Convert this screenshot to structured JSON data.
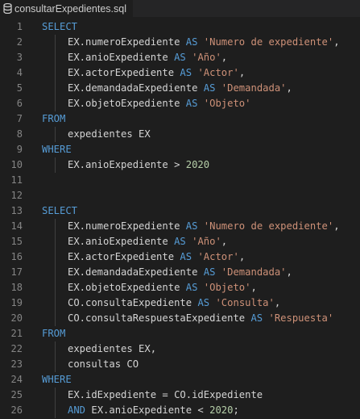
{
  "tab": {
    "title": "consultarExpedientes.sql",
    "icon": "database-icon"
  },
  "colors": {
    "keyword": "#569cd6",
    "string": "#ce9178",
    "number": "#b5cea8",
    "text": "#d4d4d4",
    "line_number": "#858585",
    "background": "#1e1e1e"
  },
  "lines": [
    {
      "n": "1",
      "indent": false,
      "tokens": [
        {
          "t": "SELECT",
          "c": "kw"
        }
      ]
    },
    {
      "n": "2",
      "indent": true,
      "tokens": [
        {
          "t": "EX.numeroExpediente ",
          "c": "id"
        },
        {
          "t": "AS",
          "c": "kw"
        },
        {
          "t": " ",
          "c": "id"
        },
        {
          "t": "'Numero de expediente'",
          "c": "str"
        },
        {
          "t": ",",
          "c": "id"
        }
      ]
    },
    {
      "n": "3",
      "indent": true,
      "tokens": [
        {
          "t": "EX.anioExpediente ",
          "c": "id"
        },
        {
          "t": "AS",
          "c": "kw"
        },
        {
          "t": " ",
          "c": "id"
        },
        {
          "t": "'Año'",
          "c": "str"
        },
        {
          "t": ",",
          "c": "id"
        }
      ]
    },
    {
      "n": "4",
      "indent": true,
      "tokens": [
        {
          "t": "EX.actorExpediente ",
          "c": "id"
        },
        {
          "t": "AS",
          "c": "kw"
        },
        {
          "t": " ",
          "c": "id"
        },
        {
          "t": "'Actor'",
          "c": "str"
        },
        {
          "t": ",",
          "c": "id"
        }
      ]
    },
    {
      "n": "5",
      "indent": true,
      "tokens": [
        {
          "t": "EX.demandadaExpediente ",
          "c": "id"
        },
        {
          "t": "AS",
          "c": "kw"
        },
        {
          "t": " ",
          "c": "id"
        },
        {
          "t": "'Demandada'",
          "c": "str"
        },
        {
          "t": ",",
          "c": "id"
        }
      ]
    },
    {
      "n": "6",
      "indent": true,
      "tokens": [
        {
          "t": "EX.objetoExpediente ",
          "c": "id"
        },
        {
          "t": "AS",
          "c": "kw"
        },
        {
          "t": " ",
          "c": "id"
        },
        {
          "t": "'Objeto'",
          "c": "str"
        }
      ]
    },
    {
      "n": "7",
      "indent": false,
      "tokens": [
        {
          "t": "FROM",
          "c": "kw"
        }
      ]
    },
    {
      "n": "8",
      "indent": true,
      "tokens": [
        {
          "t": "expedientes EX",
          "c": "id"
        }
      ]
    },
    {
      "n": "9",
      "indent": false,
      "tokens": [
        {
          "t": "WHERE",
          "c": "kw"
        }
      ]
    },
    {
      "n": "10",
      "indent": true,
      "tokens": [
        {
          "t": "EX.anioExpediente > ",
          "c": "id"
        },
        {
          "t": "2020",
          "c": "num"
        }
      ]
    },
    {
      "n": "11",
      "indent": false,
      "tokens": []
    },
    {
      "n": "12",
      "indent": false,
      "tokens": []
    },
    {
      "n": "13",
      "indent": false,
      "tokens": [
        {
          "t": "SELECT",
          "c": "kw"
        }
      ]
    },
    {
      "n": "14",
      "indent": true,
      "tokens": [
        {
          "t": "EX.numeroExpediente ",
          "c": "id"
        },
        {
          "t": "AS",
          "c": "kw"
        },
        {
          "t": " ",
          "c": "id"
        },
        {
          "t": "'Numero de expediente'",
          "c": "str"
        },
        {
          "t": ",",
          "c": "id"
        }
      ]
    },
    {
      "n": "15",
      "indent": true,
      "tokens": [
        {
          "t": "EX.anioExpediente ",
          "c": "id"
        },
        {
          "t": "AS",
          "c": "kw"
        },
        {
          "t": " ",
          "c": "id"
        },
        {
          "t": "'Año'",
          "c": "str"
        },
        {
          "t": ",",
          "c": "id"
        }
      ]
    },
    {
      "n": "16",
      "indent": true,
      "tokens": [
        {
          "t": "EX.actorExpediente ",
          "c": "id"
        },
        {
          "t": "AS",
          "c": "kw"
        },
        {
          "t": " ",
          "c": "id"
        },
        {
          "t": "'Actor'",
          "c": "str"
        },
        {
          "t": ",",
          "c": "id"
        }
      ]
    },
    {
      "n": "17",
      "indent": true,
      "tokens": [
        {
          "t": "EX.demandadaExpediente ",
          "c": "id"
        },
        {
          "t": "AS",
          "c": "kw"
        },
        {
          "t": " ",
          "c": "id"
        },
        {
          "t": "'Demandada'",
          "c": "str"
        },
        {
          "t": ",",
          "c": "id"
        }
      ]
    },
    {
      "n": "18",
      "indent": true,
      "tokens": [
        {
          "t": "EX.objetoExpediente ",
          "c": "id"
        },
        {
          "t": "AS",
          "c": "kw"
        },
        {
          "t": " ",
          "c": "id"
        },
        {
          "t": "'Objeto'",
          "c": "str"
        },
        {
          "t": ",",
          "c": "id"
        }
      ]
    },
    {
      "n": "19",
      "indent": true,
      "tokens": [
        {
          "t": "CO.consultaExpediente ",
          "c": "id"
        },
        {
          "t": "AS",
          "c": "kw"
        },
        {
          "t": " ",
          "c": "id"
        },
        {
          "t": "'Consulta'",
          "c": "str"
        },
        {
          "t": ",",
          "c": "id"
        }
      ]
    },
    {
      "n": "20",
      "indent": true,
      "tokens": [
        {
          "t": "CO.consultaRespuestaExpediente ",
          "c": "id"
        },
        {
          "t": "AS",
          "c": "kw"
        },
        {
          "t": " ",
          "c": "id"
        },
        {
          "t": "'Respuesta'",
          "c": "str"
        }
      ]
    },
    {
      "n": "21",
      "indent": false,
      "tokens": [
        {
          "t": "FROM",
          "c": "kw"
        }
      ]
    },
    {
      "n": "22",
      "indent": true,
      "tokens": [
        {
          "t": "expedientes EX,",
          "c": "id"
        }
      ]
    },
    {
      "n": "23",
      "indent": true,
      "tokens": [
        {
          "t": "consultas CO",
          "c": "id"
        }
      ]
    },
    {
      "n": "24",
      "indent": false,
      "tokens": [
        {
          "t": "WHERE",
          "c": "kw"
        }
      ]
    },
    {
      "n": "25",
      "indent": true,
      "tokens": [
        {
          "t": "EX.idExpediente = CO.idExpediente",
          "c": "id"
        }
      ]
    },
    {
      "n": "26",
      "indent": true,
      "tokens": [
        {
          "t": "AND",
          "c": "kw"
        },
        {
          "t": " EX.anioExpediente < ",
          "c": "id"
        },
        {
          "t": "2020",
          "c": "num"
        },
        {
          "t": ";",
          "c": "id"
        }
      ]
    }
  ]
}
